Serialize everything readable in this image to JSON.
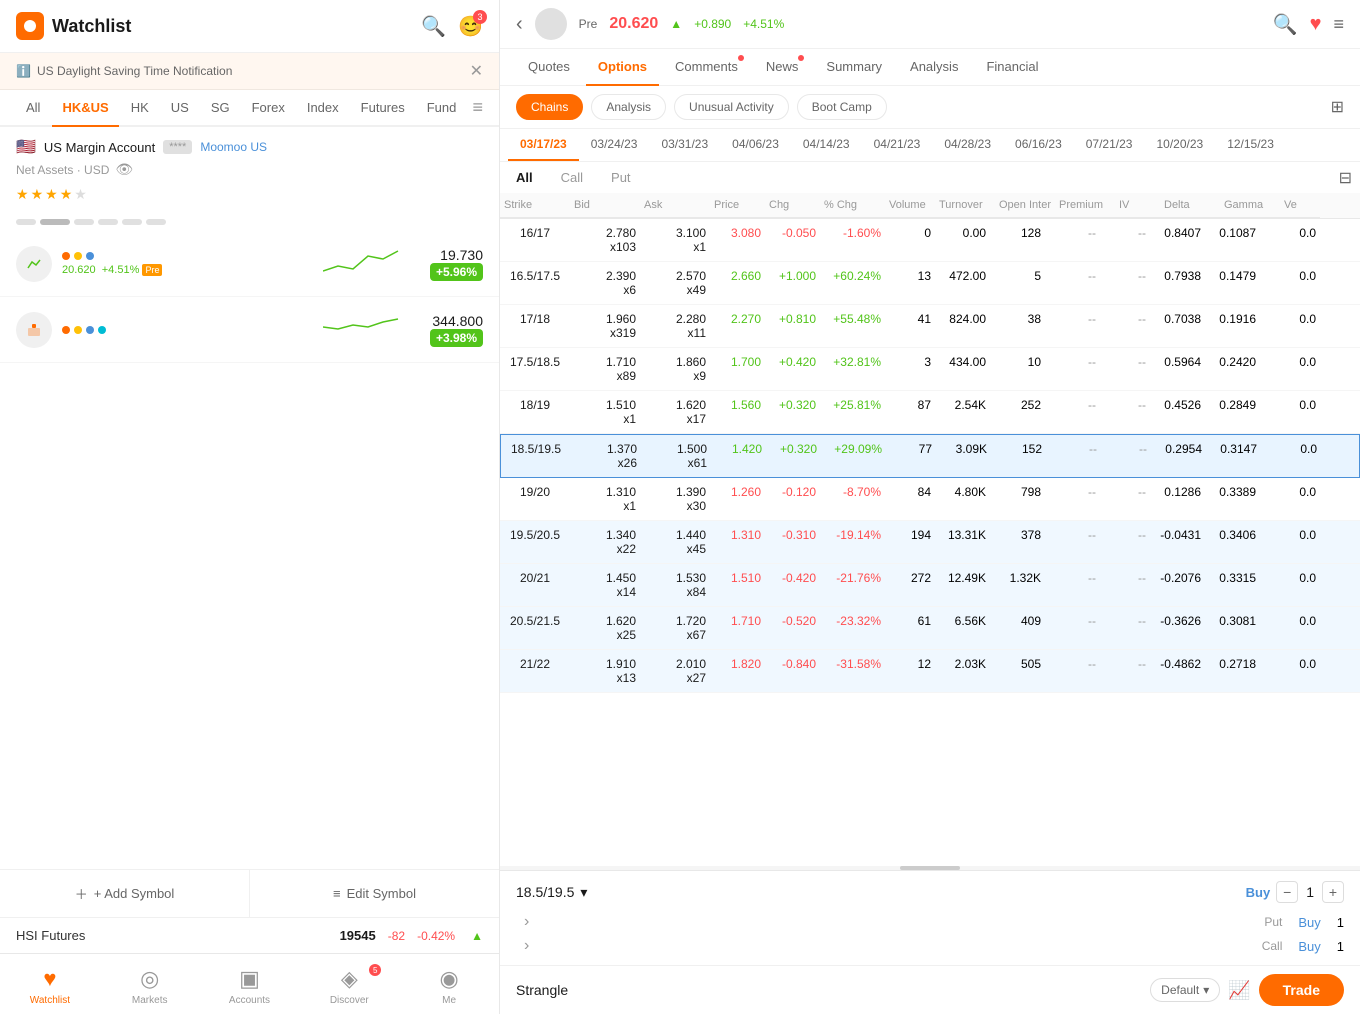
{
  "app": {
    "title": "Watchlist",
    "logo_color": "#ff6b00"
  },
  "left": {
    "notification": {
      "text": "US Daylight Saving Time Notification",
      "icon": "ℹ️"
    },
    "tabs": [
      "All",
      "HK&US",
      "HK",
      "US",
      "SG",
      "Forex",
      "Index",
      "Futures",
      "Fund"
    ],
    "active_tab": "HK&US",
    "account": {
      "flag": "🇺🇸",
      "name": "US Margin Account",
      "mask": "****",
      "platform": "Moomoo US"
    },
    "net_assets_label": "Net Assets · USD",
    "stars": [
      true,
      true,
      true,
      true,
      false
    ],
    "stocks": [
      {
        "price": "19.730",
        "change": "+5.96%",
        "change_raw": "+5.96%",
        "is_positive": true,
        "sub": "20.620  +4.51%",
        "has_pre": true
      },
      {
        "price": "344.800",
        "change": "+3.98%",
        "is_positive": true,
        "sub": "",
        "has_pre": false
      }
    ],
    "add_symbol": "+ Add Symbol",
    "edit_symbol": "Edit Symbol",
    "hsi": {
      "label": "HSI Futures",
      "value": "19545",
      "change": "-82",
      "pct": "-0.42%"
    }
  },
  "nav": {
    "items": [
      {
        "label": "Watchlist",
        "icon": "♥",
        "active": true
      },
      {
        "label": "Markets",
        "icon": "◎",
        "active": false
      },
      {
        "label": "Accounts",
        "icon": "▣",
        "active": false
      },
      {
        "label": "Discover",
        "icon": "◈",
        "active": false
      },
      {
        "label": "Me",
        "icon": "◉",
        "active": false
      }
    ]
  },
  "right": {
    "header": {
      "pre_label": "Pre",
      "price": "20.620",
      "arrow": "▲",
      "change": "+0.890",
      "pct": "+4.51%"
    },
    "main_tabs": [
      {
        "label": "Quotes",
        "active": false,
        "dot": false
      },
      {
        "label": "Options",
        "active": true,
        "dot": false
      },
      {
        "label": "Comments",
        "active": false,
        "dot": true
      },
      {
        "label": "News",
        "active": false,
        "dot": true
      },
      {
        "label": "Summary",
        "active": false,
        "dot": false
      },
      {
        "label": "Analysis",
        "active": false,
        "dot": false
      },
      {
        "label": "Financial",
        "active": false,
        "dot": false
      }
    ],
    "filters": [
      {
        "label": "Chains",
        "active": true
      },
      {
        "label": "Analysis",
        "active": false
      },
      {
        "label": "Unusual Activity",
        "active": false
      },
      {
        "label": "Boot Camp",
        "active": false
      }
    ],
    "date_tabs": [
      "03/17/23",
      "03/24/23",
      "03/31/23",
      "04/06/23",
      "04/14/23",
      "04/21/23",
      "04/28/23",
      "06/16/23",
      "07/21/23",
      "10/20/23",
      "12/15/23"
    ],
    "active_date": "03/17/23",
    "view_tabs": [
      "All",
      "Call",
      "Put"
    ],
    "active_view": "All",
    "columns": [
      "Strike",
      "Bid",
      "Ask",
      "Price",
      "Chg",
      "% Chg",
      "Volume",
      "Turnover",
      "Open Inter",
      "Premium",
      "IV",
      "Delta",
      "Gamma",
      "Ve"
    ],
    "rows": [
      {
        "strike": "16/17",
        "bid": "2.780\nx103",
        "ask": "3.100\nx1",
        "price": "3.080",
        "chg": "-0.050",
        "pct_chg": "-1.60%",
        "volume": "0",
        "turnover": "0.00",
        "open_int": "128",
        "premium": "--",
        "iv": "--",
        "delta": "0.8407",
        "gamma": "0.1087",
        "ve": "0.0",
        "pos": false,
        "selected": false
      },
      {
        "strike": "16.5/17.5",
        "bid": "2.390\nx6",
        "ask": "2.570\nx49",
        "price": "2.660",
        "chg": "+1.000",
        "pct_chg": "+60.24%",
        "volume": "13",
        "turnover": "472.00",
        "open_int": "5",
        "premium": "--",
        "iv": "--",
        "delta": "0.7938",
        "gamma": "0.1479",
        "ve": "0.0",
        "pos": true,
        "selected": false
      },
      {
        "strike": "17/18",
        "bid": "1.960\nx319",
        "ask": "2.280\nx11",
        "price": "2.270",
        "chg": "+0.810",
        "pct_chg": "+55.48%",
        "volume": "41",
        "turnover": "824.00",
        "open_int": "38",
        "premium": "--",
        "iv": "--",
        "delta": "0.7038",
        "gamma": "0.1916",
        "ve": "0.0",
        "pos": true,
        "selected": false
      },
      {
        "strike": "17.5/18.5",
        "bid": "1.710\nx89",
        "ask": "1.860\nx9",
        "price": "1.700",
        "chg": "+0.420",
        "pct_chg": "+32.81%",
        "volume": "3",
        "turnover": "434.00",
        "open_int": "10",
        "premium": "--",
        "iv": "--",
        "delta": "0.5964",
        "gamma": "0.2420",
        "ve": "0.0",
        "pos": true,
        "selected": false
      },
      {
        "strike": "18/19",
        "bid": "1.510\nx1",
        "ask": "1.620\nx17",
        "price": "1.560",
        "chg": "+0.320",
        "pct_chg": "+25.81%",
        "volume": "87",
        "turnover": "2.54K",
        "open_int": "252",
        "premium": "--",
        "iv": "--",
        "delta": "0.4526",
        "gamma": "0.2849",
        "ve": "0.0",
        "pos": true,
        "selected": false
      },
      {
        "strike": "18.5/19.5",
        "bid": "1.370\nx26",
        "ask": "1.500\nx61",
        "price": "1.420",
        "chg": "+0.320",
        "pct_chg": "+29.09%",
        "volume": "77",
        "turnover": "3.09K",
        "open_int": "152",
        "premium": "--",
        "iv": "--",
        "delta": "0.2954",
        "gamma": "0.3147",
        "ve": "0.0",
        "pos": true,
        "selected": true
      },
      {
        "strike": "19/20",
        "bid": "1.310\nx1",
        "ask": "1.390\nx30",
        "price": "1.260",
        "chg": "-0.120",
        "pct_chg": "-8.70%",
        "volume": "84",
        "turnover": "4.80K",
        "open_int": "798",
        "premium": "--",
        "iv": "--",
        "delta": "0.1286",
        "gamma": "0.3389",
        "ve": "0.0",
        "pos": false,
        "selected": false
      },
      {
        "strike": "19.5/20.5",
        "bid": "1.340\nx22",
        "ask": "1.440\nx45",
        "price": "1.310",
        "chg": "-0.310",
        "pct_chg": "-19.14%",
        "volume": "194",
        "turnover": "13.31K",
        "open_int": "378",
        "premium": "--",
        "iv": "--",
        "delta": "-0.0431",
        "gamma": "0.3406",
        "ve": "0.0",
        "pos": false,
        "selected": false,
        "highlighted": true
      },
      {
        "strike": "20/21",
        "bid": "1.450\nx14",
        "ask": "1.530\nx84",
        "price": "1.510",
        "chg": "-0.420",
        "pct_chg": "-21.76%",
        "volume": "272",
        "turnover": "12.49K",
        "open_int": "1.32K",
        "premium": "--",
        "iv": "--",
        "delta": "-0.2076",
        "gamma": "0.3315",
        "ve": "0.0",
        "pos": false,
        "selected": false,
        "highlighted": true
      },
      {
        "strike": "20.5/21.5",
        "bid": "1.620\nx25",
        "ask": "1.720\nx67",
        "price": "1.710",
        "chg": "-0.520",
        "pct_chg": "-23.32%",
        "volume": "61",
        "turnover": "6.56K",
        "open_int": "409",
        "premium": "--",
        "iv": "--",
        "delta": "-0.3626",
        "gamma": "0.3081",
        "ve": "0.0",
        "pos": false,
        "selected": false,
        "highlighted": true
      },
      {
        "strike": "21/22",
        "bid": "1.910\nx13",
        "ask": "2.010\nx27",
        "price": "1.820",
        "chg": "-0.840",
        "pct_chg": "-31.58%",
        "volume": "12",
        "turnover": "2.03K",
        "open_int": "505",
        "premium": "--",
        "iv": "--",
        "delta": "-0.4862",
        "gamma": "0.2718",
        "ve": "0.0",
        "pos": false,
        "selected": false,
        "highlighted": true
      }
    ],
    "order_bar": {
      "pair": "18.5/19.5",
      "chevron": "▾",
      "buy_label": "Buy",
      "qty": "1",
      "put_label": "Put",
      "put_action": "Buy",
      "put_qty": "1",
      "call_label": "Call",
      "call_action": "Buy",
      "call_qty": "1",
      "minus": "−",
      "plus": "+"
    },
    "strangle": {
      "label": "Strangle",
      "default_label": "Default",
      "trade_label": "Trade"
    }
  }
}
